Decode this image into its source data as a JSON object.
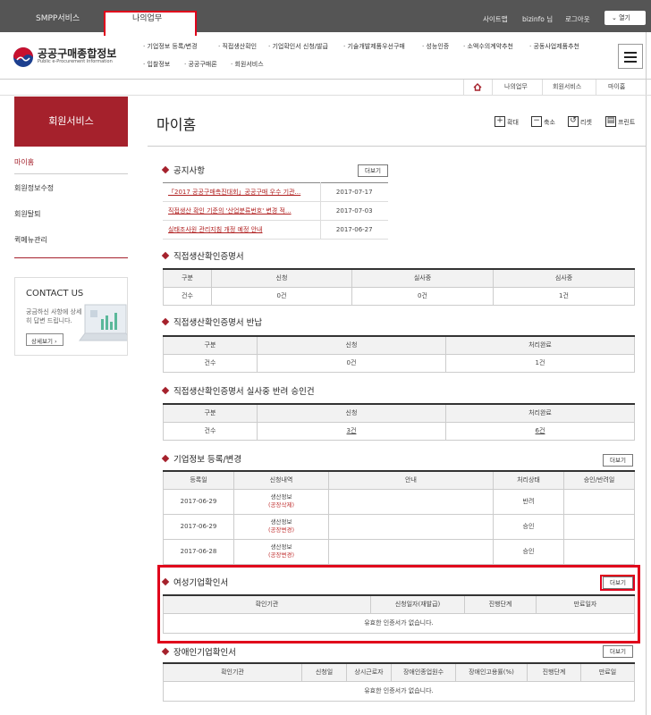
{
  "topbar": {
    "tabs": [
      "SMPP서비스",
      "나의업무"
    ],
    "links": [
      "사이트맵",
      "bizinfo 님",
      "로그아웃"
    ],
    "open_label": "열기"
  },
  "logo": {
    "title": "공공구매종합정보",
    "subtitle": "Public e-Procurement Information"
  },
  "gnb": {
    "row1": [
      "· 기업정보 등록/변경",
      "· 직접생산확인",
      "· 기업확인서 신청/발급",
      "· 기술개발제품우선구매",
      "· 성능인증",
      "· 소액수의계약추천",
      "· 공동사업제품추천"
    ],
    "row2": [
      "· 입찰정보",
      "· 공공구매론",
      "· 회원서비스"
    ]
  },
  "breadcrumb": [
    "나의업무",
    "회원서비스",
    "마이홈"
  ],
  "left": {
    "banner": "회원서비스",
    "menu": [
      "마이홈",
      "회원정보수정",
      "회원탈퇴",
      "퀵메뉴관리"
    ],
    "contact": {
      "title": "CONTACT US",
      "desc": "궁금하신 사항에 상세히 답변 드립니다.",
      "button": "상세보기"
    }
  },
  "page": {
    "title": "마이홈",
    "tools": [
      "확대",
      "축소",
      "리셋",
      "프린트"
    ]
  },
  "more_label": "더보기",
  "notice": {
    "title": "공지사항",
    "rows": [
      {
        "title": "「2017 공공구매촉진대회」공공구매 우수 기관...",
        "date": "2017-07-17"
      },
      {
        "title": "직접생산 확인 기준의 '산업분류번호' 변경 적...",
        "date": "2017-07-03"
      },
      {
        "title": "실태조사원 관리지침 개정 예정 안내",
        "date": "2017-06-27"
      }
    ]
  },
  "cert": {
    "title": "직접생산확인증명서",
    "headers": [
      "구분",
      "신청",
      "실사중",
      "심사중"
    ],
    "row": [
      "건수",
      "0건",
      "0건",
      "1건"
    ]
  },
  "cert_return": {
    "title": "직접생산확인증명서 반납",
    "headers": [
      "구분",
      "신청",
      "처리완료"
    ],
    "row": [
      "건수",
      "0건",
      "1건"
    ]
  },
  "cert_reject": {
    "title": "직접생산확인증명서 실사중 반려 승인건",
    "headers": [
      "구분",
      "신청",
      "처리완료"
    ],
    "row": [
      "건수",
      "3건",
      "6건"
    ]
  },
  "company": {
    "title": "기업정보 등록/변경",
    "headers": [
      "등록일",
      "신청내역",
      "안내",
      "처리상태",
      "승인/반려일"
    ],
    "rows": [
      {
        "date": "2017-06-29",
        "item": "생산정보",
        "sub": "(공장삭제)",
        "guide": "",
        "status": "반려",
        "done": ""
      },
      {
        "date": "2017-06-29",
        "item": "생산정보",
        "sub": "(공장변경)",
        "guide": "",
        "status": "승인",
        "done": ""
      },
      {
        "date": "2017-06-28",
        "item": "생산정보",
        "sub": "(공장변경)",
        "guide": "",
        "status": "승인",
        "done": ""
      }
    ]
  },
  "women": {
    "title": "여성기업확인서",
    "headers": [
      "확인기관",
      "신청일자(재발급)",
      "진행단계",
      "만료일자"
    ],
    "empty": "유효한 인증서가 없습니다."
  },
  "disabled": {
    "title": "장애인기업확인서",
    "headers": [
      "확인기관",
      "신청일",
      "상시근로자",
      "장애인종업원수",
      "장애인고용률(%)",
      "진행단계",
      "만료일"
    ],
    "empty": "유효한 인증서가 없습니다."
  },
  "colors": {
    "accent": "#a5212c",
    "highlight": "#e0001b",
    "topbar": "#555555"
  }
}
